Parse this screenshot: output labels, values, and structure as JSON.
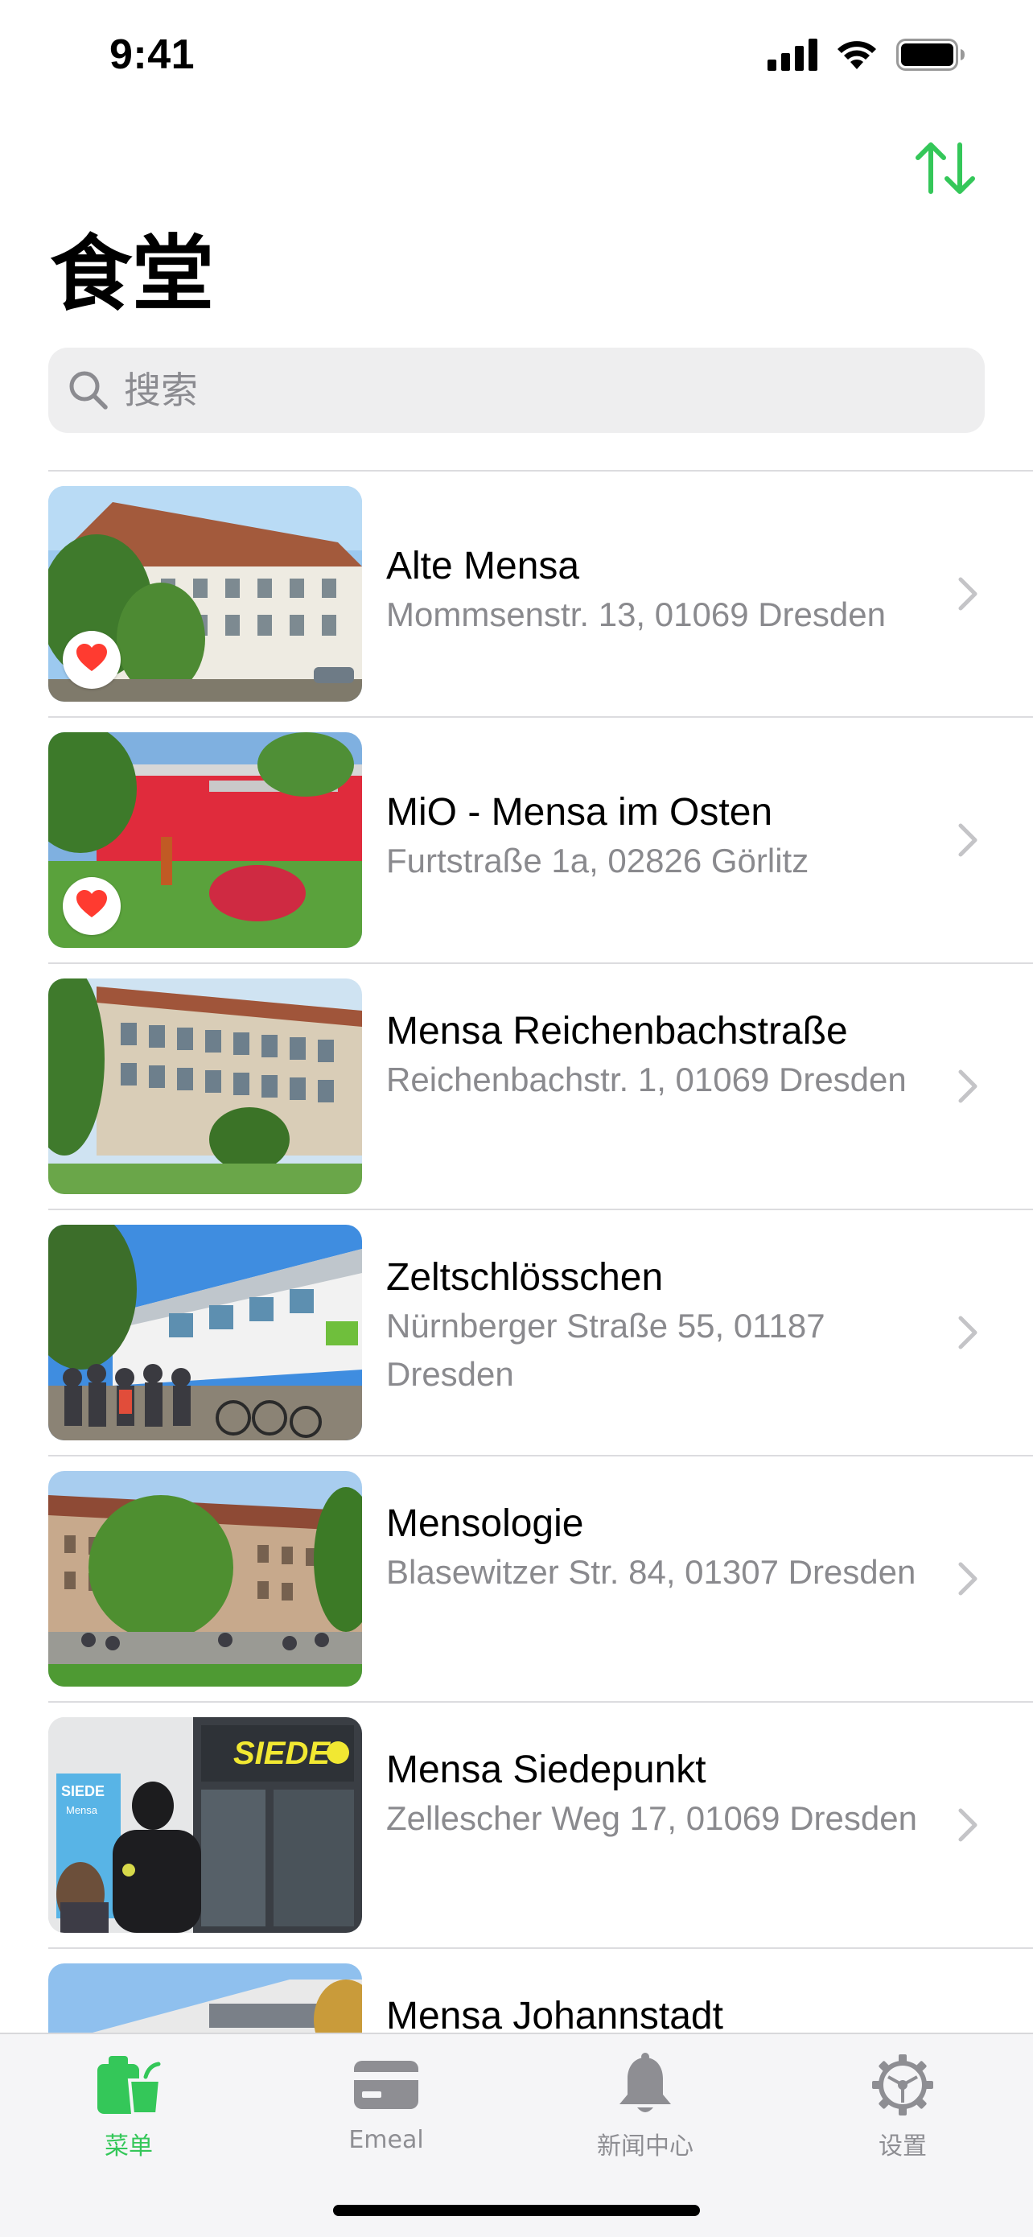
{
  "status_bar": {
    "time": "9:41",
    "icons": [
      "cellular-signal-icon",
      "wifi-icon",
      "battery-icon"
    ]
  },
  "toolbar": {
    "sort_icon": "sort-arrows-icon"
  },
  "title": "食堂",
  "search": {
    "placeholder": "搜索",
    "value": "",
    "icon": "search-icon"
  },
  "colors": {
    "accent": "#34c759",
    "heart": "#ff3b30",
    "secondary_text": "#8a8a8e"
  },
  "mensas": [
    {
      "name": "Alte Mensa",
      "address": "Mommsenstr. 13, 01069 Dresden",
      "favorite": true
    },
    {
      "name": "MiO - Mensa im Osten",
      "address": "Furtstraße 1a, 02826 Görlitz",
      "favorite": true
    },
    {
      "name": "Mensa Reichenbachstraße",
      "address": "Reichenbachstr. 1, 01069 Dresden",
      "favorite": false
    },
    {
      "name": "Zeltschlösschen",
      "address": "Nürnberger Straße 55, 01187 Dresden",
      "favorite": false
    },
    {
      "name": "Mensologie",
      "address": "Blasewitzer Str. 84, 01307 Dresden",
      "favorite": false
    },
    {
      "name": "Mensa Siedepunkt",
      "address": "Zellescher Weg 17, 01069 Dresden",
      "favorite": false,
      "sign_text": "SIEDE",
      "poster_text": "SIEDE",
      "poster_subtext": "Mensa"
    },
    {
      "name": "Mensa Johannstadt",
      "address": "",
      "favorite": false
    }
  ],
  "tabs": [
    {
      "label": "菜单",
      "icon": "menu-bag-icon",
      "active": true
    },
    {
      "label": "Emeal",
      "icon": "card-icon",
      "active": false
    },
    {
      "label": "新闻中心",
      "icon": "bell-icon",
      "active": false
    },
    {
      "label": "设置",
      "icon": "gear-icon",
      "active": false
    }
  ]
}
